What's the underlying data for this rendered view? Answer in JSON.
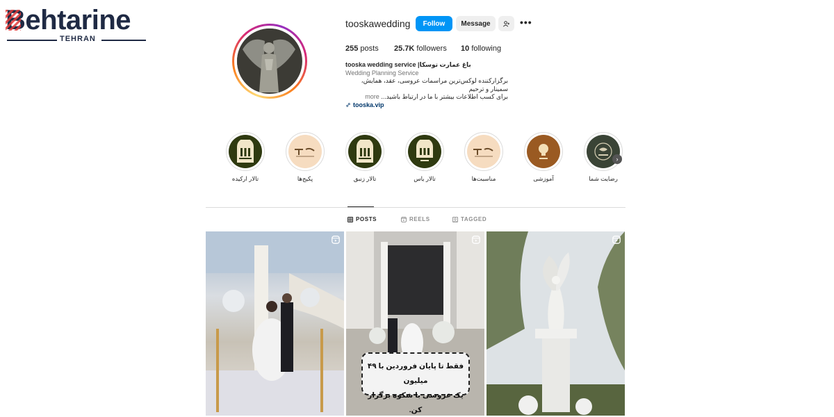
{
  "logo": {
    "word": "ehtarine",
    "letter": "B",
    "sub": "TEHRAN"
  },
  "profile": {
    "username": "tooskawedding",
    "follow_label": "Follow",
    "message_label": "Message",
    "more_icon": "ellipsis-icon",
    "add_person_icon": "add-person-icon",
    "stats": {
      "posts_count": "255",
      "posts_label": "posts",
      "followers_count": "25.7K",
      "followers_label": "followers",
      "following_count": "10",
      "following_label": "following"
    },
    "bio": {
      "name": "tooska wedding service |باغ عمارت توسکا",
      "category": "Wedding Planning Service",
      "line1": "برگزارکننده لوکس‌ترین مراسمات عروسی، عقد، همایش، سمینار و ترحیم",
      "line2": "برای کسب اطلاعات بیشتر با ما در ارتباط باشید...",
      "more": "more",
      "link": "tooska.vip"
    }
  },
  "highlights": [
    {
      "label": "تالار ارکیده",
      "bg": "#2f3a10",
      "kind": "halls"
    },
    {
      "label": "پکیج‌ها",
      "bg": "#f6dcc0",
      "kind": "tooska"
    },
    {
      "label": "تالار زنبق",
      "bg": "#2f3a10",
      "kind": "halls"
    },
    {
      "label": "تالار یاس",
      "bg": "#2f3a10",
      "kind": "yas"
    },
    {
      "label": "مناسبت‌ها",
      "bg": "#f6dcc0",
      "kind": "tooska"
    },
    {
      "label": "آموزشی",
      "bg": "#9a5a22",
      "kind": "tips"
    },
    {
      "label": "رضایت شما",
      "bg": "#3a4436",
      "kind": "comment"
    }
  ],
  "tabs": [
    {
      "label": "POSTS",
      "active": true,
      "icon": "grid-icon"
    },
    {
      "label": "REELS",
      "active": false,
      "icon": "reels-icon"
    },
    {
      "label": "TAGGED",
      "active": false,
      "icon": "tagged-icon"
    }
  ],
  "posts": {
    "promo_line1": "فقط تا پایان فروردین با ۴۹ میلیون",
    "promo_line2": "یک عروسی با شکوه برگزار کن."
  },
  "colors": {
    "accent": "#0095f6",
    "text": "#262626",
    "muted": "#737373",
    "link": "#00376b"
  }
}
